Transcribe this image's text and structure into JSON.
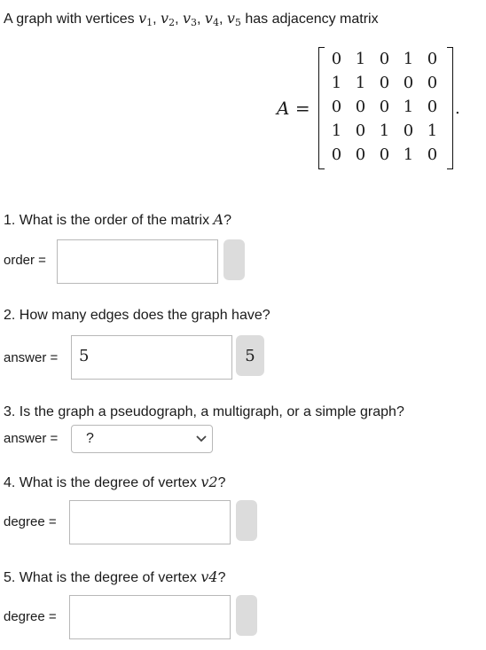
{
  "intro": {
    "prefix": "A graph with vertices ",
    "v1": "v",
    "v1_sub": "1",
    "v2": "v",
    "v2_sub": "2",
    "v3": "v",
    "v3_sub": "3",
    "v4": "v",
    "v4_sub": "4",
    "v5": "v",
    "v5_sub": "5",
    "sep": ", ",
    "suffix": " has adjacency matrix"
  },
  "matrix": {
    "label": "A",
    "equals": "=",
    "period": ".",
    "rows": [
      [
        "0",
        "1",
        "0",
        "1",
        "0"
      ],
      [
        "1",
        "1",
        "0",
        "0",
        "0"
      ],
      [
        "0",
        "0",
        "0",
        "1",
        "0"
      ],
      [
        "1",
        "0",
        "1",
        "0",
        "1"
      ],
      [
        "0",
        "0",
        "0",
        "1",
        "0"
      ]
    ]
  },
  "q1": {
    "text": "1. What is the order of the matrix ",
    "var": "A",
    "end": "?",
    "label": "order =",
    "value": ""
  },
  "q2": {
    "text": "2. How many edges does the graph have?",
    "label": "answer =",
    "value": "5",
    "preview": "5"
  },
  "q3": {
    "text": "3. Is the graph a pseudograph, a multigraph, or a simple graph?",
    "label": "answer =",
    "selected": "?"
  },
  "q4": {
    "text": "4. What is the degree of vertex ",
    "var": "v2",
    "end": "?",
    "label": "degree =",
    "value": ""
  },
  "q5": {
    "text": "5. What is the degree of vertex ",
    "var": "v4",
    "end": "?",
    "label": "degree =",
    "value": ""
  },
  "icons": {
    "dropdown": "chevron-down-icon"
  }
}
